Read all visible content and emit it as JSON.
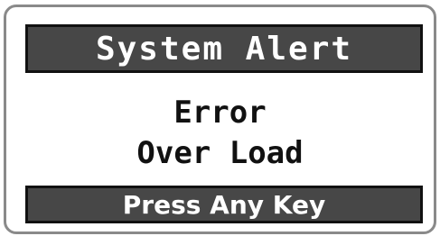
{
  "alert": {
    "title": "System Alert",
    "message_line1": "Error",
    "message_line2": "Over Load",
    "prompt": "Press Any Key"
  },
  "colors": {
    "bar_background": "#474747",
    "bar_text": "#ffffff",
    "message_text": "#111111",
    "frame_border": "#8a8a8a"
  }
}
